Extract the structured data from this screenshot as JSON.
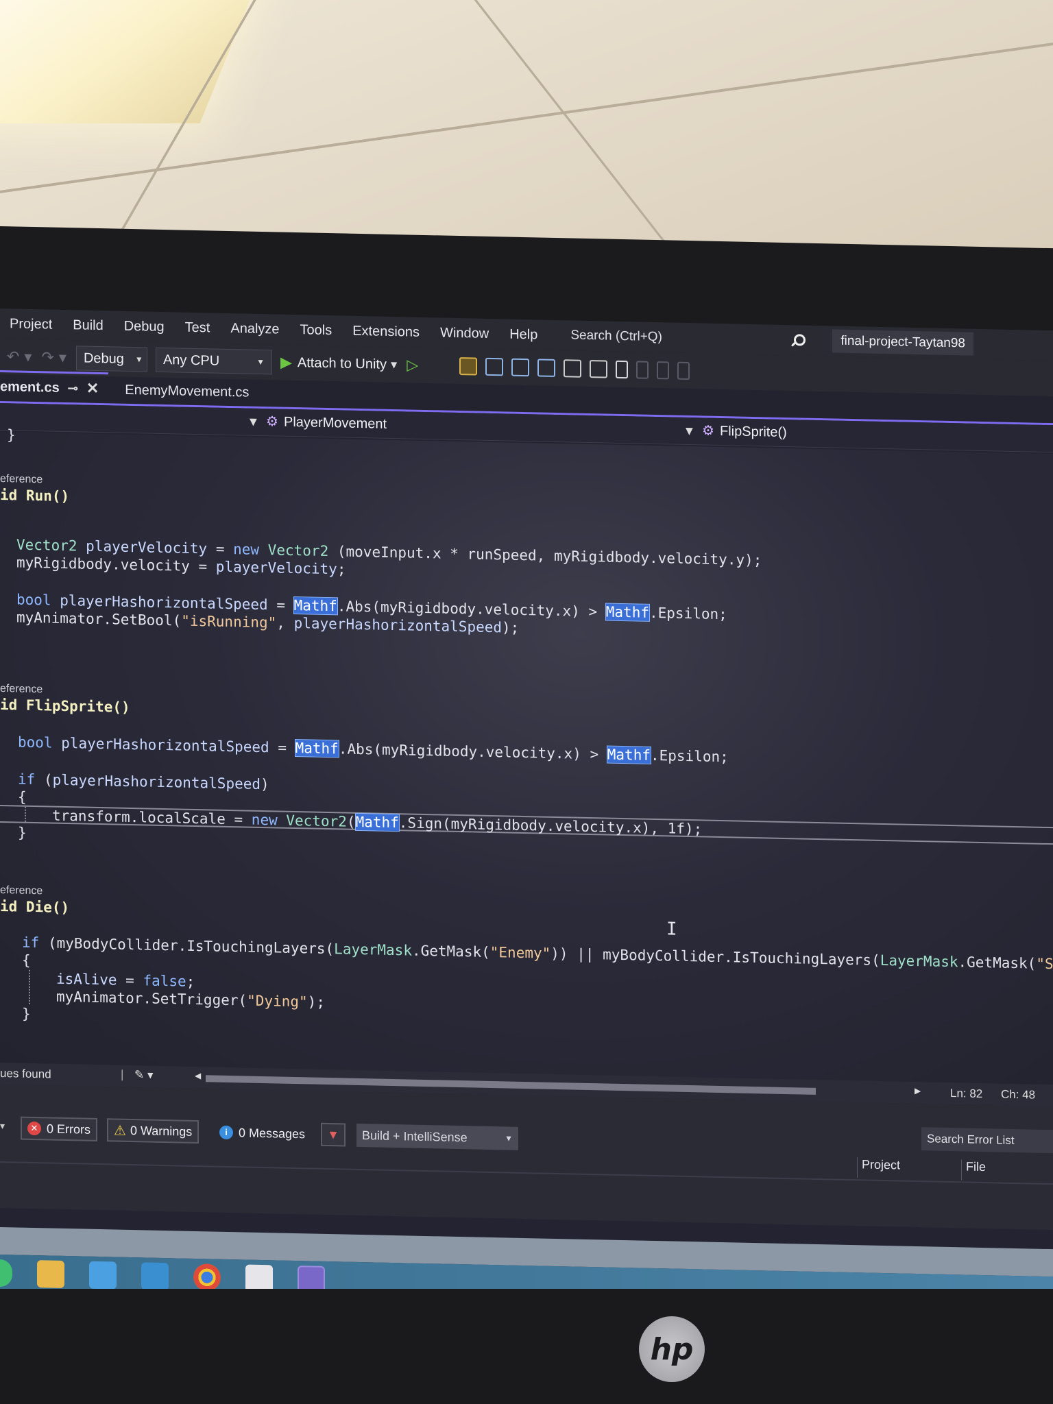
{
  "menu": {
    "items": [
      "Project",
      "Build",
      "Debug",
      "Test",
      "Analyze",
      "Tools",
      "Extensions",
      "Window",
      "Help"
    ],
    "search_placeholder": "Search (Ctrl+Q)",
    "project_name": "final-project-Taytan98"
  },
  "toolbar": {
    "config": "Debug",
    "platform": "Any CPU",
    "attach_label": "Attach to Unity"
  },
  "tabs": [
    {
      "label": "ement.cs",
      "active": true
    },
    {
      "label": "EnemyMovement.cs",
      "active": false
    }
  ],
  "navbar": {
    "class_name": "PlayerMovement",
    "member_name": "FlipSprite()"
  },
  "code": {
    "ref1": "eference",
    "run_sig": "id Run()",
    "ref2": "eference",
    "flip_sig": "id FlipSprite()",
    "ref3": "eference",
    "die_sig": "id Die()"
  },
  "editor_status": {
    "issues": "ues found",
    "line": "Ln: 82",
    "col": "Ch: 48"
  },
  "error_list": {
    "errors": "0 Errors",
    "warnings": "0 Warnings",
    "messages": "0 Messages",
    "build_filter": "Build + IntelliSense",
    "search_placeholder": "Search Error List",
    "col_project": "Project",
    "col_file": "File"
  },
  "brand": {
    "monitor_logo": "hp"
  },
  "colors": {
    "accent": "#7d6cf0",
    "taskbar": "#3a6e8e"
  }
}
